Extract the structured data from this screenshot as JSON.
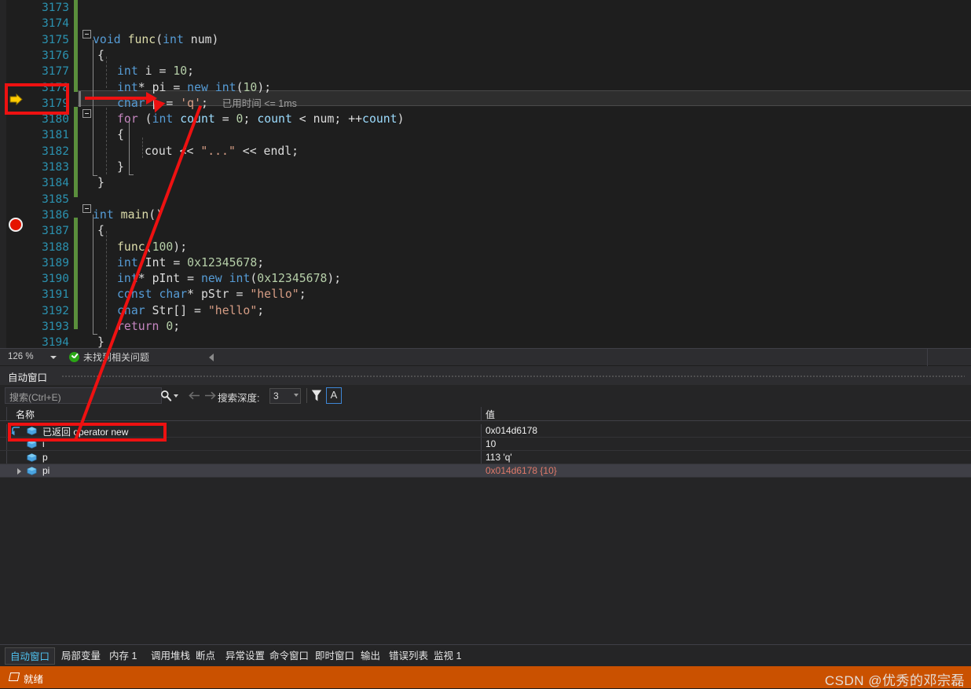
{
  "editor": {
    "first_line": 3173,
    "current_exec_line": 3179,
    "breakpoint_line": 3187,
    "inline_hint": "已用时间 <= 1ms",
    "lines": [
      {
        "n": 3173,
        "text": ""
      },
      {
        "n": 3174,
        "text": ""
      },
      {
        "n": 3175,
        "text": "void func(int num)"
      },
      {
        "n": 3176,
        "text": "{"
      },
      {
        "n": 3177,
        "text": "    int i = 10;"
      },
      {
        "n": 3178,
        "text": "    int* pi = new int(10);"
      },
      {
        "n": 3179,
        "text": "    char p = 'q';"
      },
      {
        "n": 3180,
        "text": "    for (int count = 0; count < num; ++count)"
      },
      {
        "n": 3181,
        "text": "    {"
      },
      {
        "n": 3182,
        "text": "        cout << \"...\" << endl;"
      },
      {
        "n": 3183,
        "text": "    }"
      },
      {
        "n": 3184,
        "text": "}"
      },
      {
        "n": 3185,
        "text": ""
      },
      {
        "n": 3186,
        "text": "int main()"
      },
      {
        "n": 3187,
        "text": "{"
      },
      {
        "n": 3188,
        "text": "    func(100);"
      },
      {
        "n": 3189,
        "text": "    int Int = 0x12345678;"
      },
      {
        "n": 3190,
        "text": "    int* pInt = new int(0x12345678);"
      },
      {
        "n": 3191,
        "text": "    const char* pStr = \"hello\";"
      },
      {
        "n": 3192,
        "text": "    char Str[] = \"hello\";"
      },
      {
        "n": 3193,
        "text": "    return 0;"
      },
      {
        "n": 3194,
        "text": "}"
      }
    ]
  },
  "editor_status": {
    "zoom": "126 %",
    "problems": "未找到相关问题"
  },
  "autos": {
    "title": "自动窗口",
    "search_placeholder": "搜索(Ctrl+E)",
    "depth_label": "搜索深度:",
    "depth_value": "3",
    "match_case_label": "A",
    "columns": [
      "名称",
      "值"
    ],
    "rows": [
      {
        "name": "已返回 operator new",
        "value": "0x014d6178",
        "indent": 0,
        "has_return_icon": true,
        "expandable": false,
        "selected": false,
        "value_red": false
      },
      {
        "name": "i",
        "value": "10",
        "indent": 1,
        "has_return_icon": false,
        "expandable": false,
        "selected": false,
        "value_red": false
      },
      {
        "name": "p",
        "value": "113 'q'",
        "indent": 1,
        "has_return_icon": false,
        "expandable": false,
        "selected": false,
        "value_red": false
      },
      {
        "name": "pi",
        "value": "0x014d6178 {10}",
        "indent": 1,
        "has_return_icon": false,
        "expandable": true,
        "selected": true,
        "value_red": true
      }
    ]
  },
  "bottom_tabs": [
    {
      "label": "自动窗口",
      "active": true
    },
    {
      "label": "局部变量",
      "active": false
    },
    {
      "label": "内存 1",
      "active": false
    },
    {
      "label": "调用堆栈",
      "active": false
    },
    {
      "label": "断点",
      "active": false
    },
    {
      "label": "异常设置",
      "active": false
    },
    {
      "label": "命令窗口",
      "active": false
    },
    {
      "label": "即时窗口",
      "active": false
    },
    {
      "label": "输出",
      "active": false
    },
    {
      "label": "错误列表",
      "active": false
    },
    {
      "label": "监视 1",
      "active": false
    }
  ],
  "status_bar": {
    "text": "就绪"
  },
  "watermark": "CSDN @优秀的邓宗磊",
  "colors": {
    "accent_orange": "#ca5100",
    "annotation_red": "#ee1111",
    "keyword_blue": "#569cd6",
    "function_yellow": "#dcdcaa",
    "string_orange": "#d69d85",
    "number_green": "#b5cea8",
    "linenumber_teal": "#2b91af",
    "breakpoint_red": "#e51400",
    "exec_arrow_yellow": "#ffcc00",
    "changebar_green": "#5a8f3c"
  }
}
